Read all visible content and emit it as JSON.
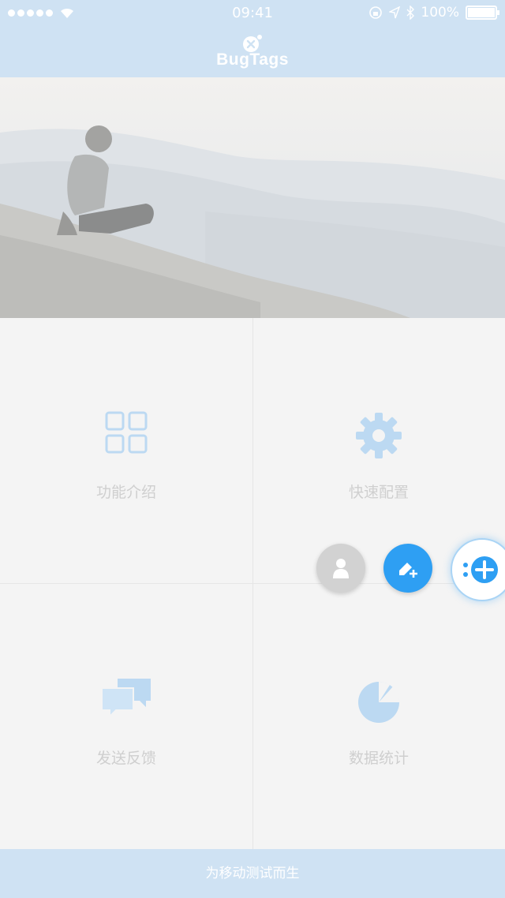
{
  "status_bar": {
    "time": "09:41",
    "battery": "100%",
    "icons": [
      "signal-dots-icon",
      "wifi-icon",
      "rotation-lock-icon",
      "location-icon",
      "bluetooth-icon",
      "battery-icon"
    ]
  },
  "nav": {
    "brand": "BugTags"
  },
  "hero": {
    "image": "man-sitting-on-stone-wall-mountain-landscape"
  },
  "grid": {
    "items": [
      {
        "label": "功能介绍",
        "icon": "grid-icon"
      },
      {
        "label": "快速配置",
        "icon": "gear-icon"
      },
      {
        "label": "发送反馈",
        "icon": "chat-bubbles-icon"
      },
      {
        "label": "数据统计",
        "icon": "pie-chart-icon"
      }
    ]
  },
  "floating_actions": {
    "buttons": [
      {
        "name": "user",
        "icon": "user-icon",
        "color": "#d2d2d2"
      },
      {
        "name": "edit",
        "icon": "edit-plus-icon",
        "color": "#2e9ff3"
      },
      {
        "name": "main",
        "icon": "bugtags-plus-icon",
        "color": "#2e9ff3"
      }
    ]
  },
  "footer": {
    "text": "为移动测试而生"
  },
  "colors": {
    "bar": "#cfe2f3",
    "accent": "#2e9ff3",
    "icon_tint": "#bcd9f2",
    "label": "#cfcfcf"
  }
}
